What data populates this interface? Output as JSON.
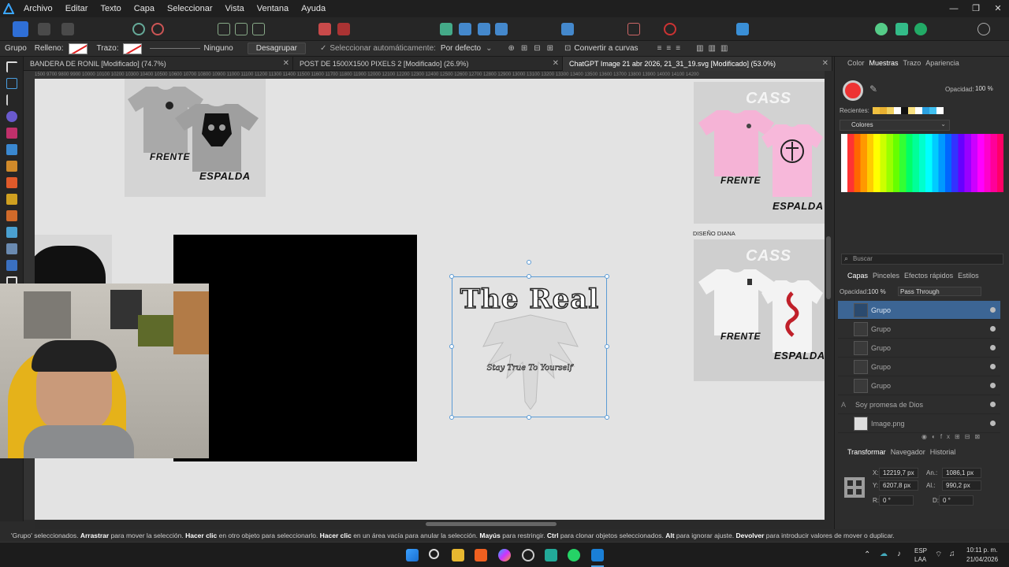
{
  "menu": [
    "Archivo",
    "Editar",
    "Texto",
    "Capa",
    "Seleccionar",
    "Vista",
    "Ventana",
    "Ayuda"
  ],
  "window_controls": [
    "—",
    "❐",
    "✕"
  ],
  "context": {
    "group_label": "Grupo",
    "fill_label": "Relleno:",
    "stroke_label": "Trazo:",
    "stroke_style": "Ninguno",
    "ungroup_button": "Desagrupar",
    "auto_select_label": "Seleccionar automáticamente:",
    "auto_select_value": "Por defecto",
    "convert_curves": "Convertir a curvas"
  },
  "tabs": [
    {
      "label": "BANDERA DE RONIL [Modificado] (74.7%)",
      "active": false
    },
    {
      "label": "POST DE 1500X1500 PIXELS 2 [Modificado] (26.9%)",
      "active": false
    },
    {
      "label": "ChatGPT Image 21 abr 2026, 21_31_19.svg [Modificado] (53.0%)",
      "active": true
    }
  ],
  "ruler_text": "1500 9700 9800 9900 10000 10100 10200 10300 10400 10500 10600 10700 10800 10900 11000 11100 11200 11300 11400 11500 11600 11700 11800 11900 12000 12100 12200 12300 12400 12500 12600 12700 12800 12900 13000 13100 13200 13300 13400 13500 13600 13700 13800 13900 14000 14100 14200",
  "canvas": {
    "mockup1": {
      "front": "FRENTE",
      "back": "ESPALDA"
    },
    "mockup2": {
      "watermark": "CASS",
      "front": "FRENTE",
      "back": "ESPALDA"
    },
    "mockup3_title": "DISEÑO DIANA",
    "mockup3": {
      "watermark": "CASS",
      "front": "FRENTE",
      "back": "ESPALDA"
    },
    "design_title": "The Real",
    "design_subtitle": "Stay True To Yourself"
  },
  "right_panel": {
    "top_tabs": [
      "Color",
      "Muestras",
      "Trazo",
      "Apariencia"
    ],
    "opacity_label": "Opacidad:",
    "opacity_value": "100 %",
    "recent_label": "Recientes:",
    "palette_name": "Colores",
    "search_placeholder": "Buscar",
    "layer_tabs": [
      "Capas",
      "Pinceles",
      "Efectos rápidos",
      "Estilos"
    ],
    "layer_opacity_label": "Opacidad:",
    "layer_opacity_value": "100 %",
    "blend_mode": "Pass Through",
    "layers": [
      {
        "name": "Grupo",
        "selected": true
      },
      {
        "name": "Grupo",
        "selected": false
      },
      {
        "name": "Grupo",
        "selected": false
      },
      {
        "name": "Grupo",
        "selected": false
      },
      {
        "name": "Grupo",
        "selected": false
      },
      {
        "name": "Soy promesa de Dios",
        "selected": false
      },
      {
        "name": "Image.png",
        "selected": false
      }
    ],
    "transform_tabs": [
      "Transformar",
      "Navegador",
      "Historial"
    ],
    "transform": {
      "x_label": "X:",
      "x": "12219,7 px",
      "y_label": "Y:",
      "y": "6207,8 px",
      "w_label": "An.:",
      "w": "1086,1 px",
      "h_label": "Al.:",
      "h": "990,2 px",
      "r_label": "R:",
      "r": "0 °",
      "s_label": "D:",
      "s": "0 °"
    }
  },
  "status": {
    "pre": "'Grupo' seleccionados. ",
    "b1": "Arrastrar",
    "t1": " para mover la selección. ",
    "b2": "Hacer clic",
    "t2": " en otro objeto para seleccionarlo. ",
    "b3": "Hacer clic",
    "t3": " en un área vacía para anular la selección. ",
    "b4": "Mayús",
    "t4": " para restringir. ",
    "b5": "Ctrl",
    "t5": " para clonar objetos seleccionados. ",
    "b6": "Alt",
    "t6": " para ignorar ajuste. ",
    "b7": "Devolver",
    "t7": " para introducir valores de mover o duplicar."
  },
  "taskbar": {
    "lang": "ESP",
    "lang2": "LAA",
    "time": "10:11 p. m.",
    "date": "21/04/2026"
  },
  "colors": {
    "accent": "#4a8fd9",
    "selected_layer": "#3c6594",
    "selection_box": "#5b9bd5"
  }
}
